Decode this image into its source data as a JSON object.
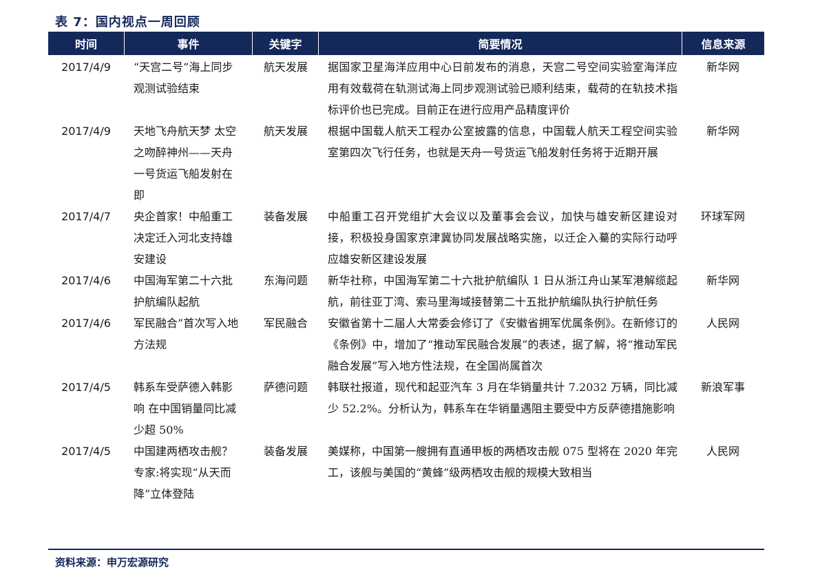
{
  "title": "表 7：国内视点一周回顾",
  "headers": {
    "time": "时间",
    "event": "事件",
    "keyword": "关键字",
    "summary": "简要情况",
    "source": "信息来源"
  },
  "rows": [
    {
      "date": "2017/4/9",
      "event": "“天宫二号”海上同步观测试验结束",
      "keyword": "航天发展",
      "summary": "据国家卫星海洋应用中心日前发布的消息，天宫二号空间实验室海洋应用有效载荷在轨测试海上同步观测试验已顺利结束，载荷的在轨技术指标评价也已完成。目前正在进行应用产品精度评价",
      "source": "新华网"
    },
    {
      "date": "2017/4/9",
      "event": "天地飞舟航天梦 太空之吻醉神州——天舟一号货运飞船发射在即",
      "keyword": "航天发展",
      "summary": "根据中国载人航天工程办公室披露的信息，中国载人航天工程空间实验室第四次飞行任务，也就是天舟一号货运飞船发射任务将于近期开展",
      "source": "新华网"
    },
    {
      "date": "2017/4/7",
      "event": "央企首家！中船重工决定迁入河北支持雄安建设",
      "keyword": "装备发展",
      "summary": "中船重工召开党组扩大会议以及董事会会议，加快与雄安新区建设对接，积极投身国家京津冀协同发展战略实施，以迁企入驀的实际行动呼应雄安新区建设发展",
      "source": "环球军网"
    },
    {
      "date": "2017/4/6",
      "event": "中国海军第二十六批护航编队起航",
      "keyword": "东海问题",
      "summary": "新华社称，中国海军第二十六批护航编队 1 日从浙江舟山某军港解缆起航，前往亚丁湾、索马里海域接替第二十五批护航编队执行护航任务",
      "source": "新华网"
    },
    {
      "date": "2017/4/6",
      "event": "军民融合”首次写入地方法规",
      "keyword": "军民融合",
      "summary": "安徽省第十二届人大常委会修订了《安徽省拥军优属条例》。在新修订的《条例》中，增加了“推动军民融合发展”的表述，据了解，将“推动军民融合发展”写入地方性法规，在全国尚属首次",
      "source": "人民网"
    },
    {
      "date": "2017/4/5",
      "event": "韩系车受萨德入韩影响 在中国销量同比减少超 50%",
      "keyword": "萨德问题",
      "summary": "韩联社报道，现代和起亚汽车 3 月在华销量共计 7.2032 万辆，同比减少 52.2%。分析认为，韩系车在华销量遇阻主要受中方反萨德措施影响",
      "source": "新浪军事"
    },
    {
      "date": "2017/4/5",
      "event": "中国建两栖攻击舰？专家:将实现“从天而降”立体登陆",
      "keyword": "装备发展",
      "summary": "美媒称，中国第一艘拥有直通甲板的两栖攻击舰 075 型将在 2020 年完工，该舰与美国的“黄蜂”级两栖攻击舰的规模大致相当",
      "source": "人民网"
    }
  ],
  "footer": {
    "source_note": "资料来源：申万宏源研究"
  },
  "colors": {
    "header_bg": "#14285a",
    "header_text": "#ffffff",
    "accent": "#14285a"
  }
}
